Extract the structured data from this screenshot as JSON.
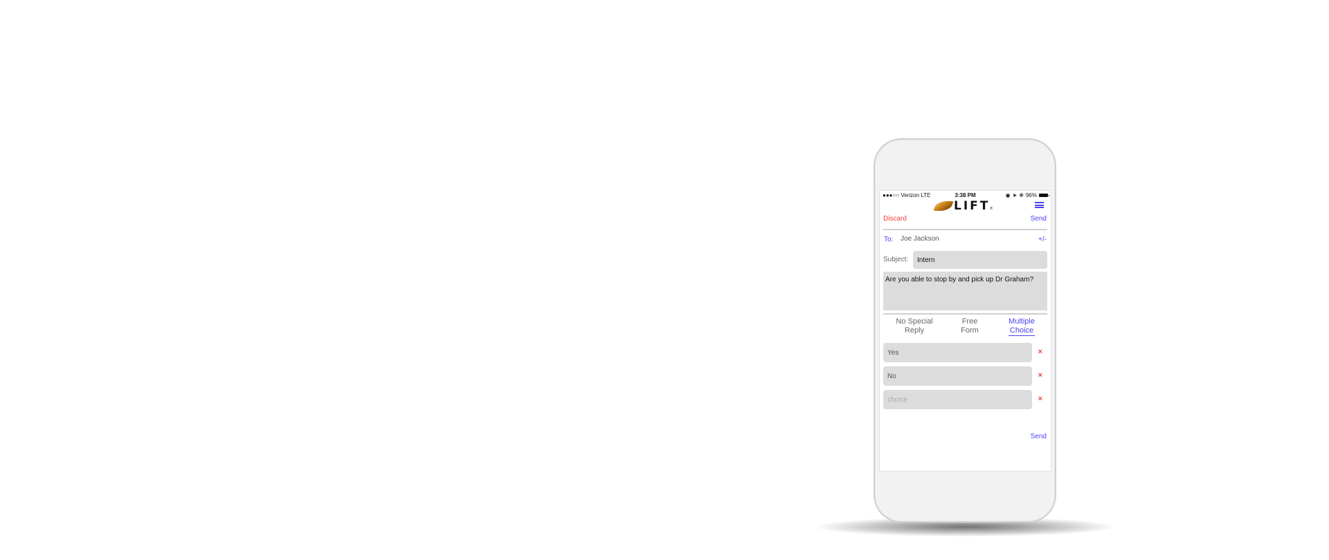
{
  "status_bar": {
    "carrier": "●●●○○ Verizon  LTE",
    "time": "3:38 PM",
    "battery": "96%"
  },
  "app": {
    "logo_text": "LIFT",
    "logo_mark": "®"
  },
  "compose": {
    "discard_label": "Discard",
    "send_label": "Send",
    "to_label": "To:",
    "to_value": "Joe Jackson",
    "recipients_toggle": "+/-",
    "subject_label": "Subject:",
    "subject_value": "Intern",
    "body_value": "Are you able to stop by and pick up Dr Graham?"
  },
  "reply_tabs": [
    {
      "label_line1": "No Special",
      "label_line2": "Reply",
      "active": false
    },
    {
      "label_line1": "Free",
      "label_line2": "Form",
      "active": false
    },
    {
      "label_line1": "Multiple",
      "label_line2": "Choice",
      "active": true
    }
  ],
  "choices": [
    {
      "value": "Yes",
      "placeholder": "choice",
      "remove": "×"
    },
    {
      "value": "No",
      "placeholder": "choice",
      "remove": "×"
    },
    {
      "value": "",
      "placeholder": "choice",
      "remove": "×"
    }
  ],
  "footer": {
    "send_label": "Send"
  },
  "colors": {
    "accent": "#4a3ff0",
    "danger": "#f23b3b",
    "field_bg": "#dcdcdc"
  }
}
